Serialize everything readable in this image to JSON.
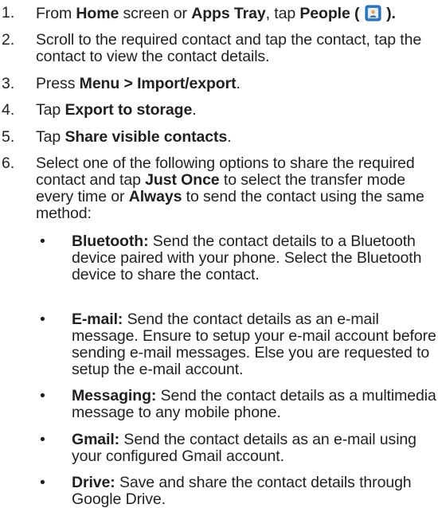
{
  "steps": [
    {
      "num": "1.",
      "parts": [
        {
          "t": "From "
        },
        {
          "t": "Home",
          "b": true
        },
        {
          "t": " screen or "
        },
        {
          "t": "Apps Tray",
          "b": true
        },
        {
          "t": ", tap "
        },
        {
          "t": "People ( ",
          "b": true
        },
        {
          "icon": "people-icon"
        },
        {
          "t": " ).",
          "b": true
        }
      ]
    },
    {
      "num": "2.",
      "parts": [
        {
          "t": "Scroll to the required contact and tap the contact, tap the contact to view the contact details."
        }
      ]
    },
    {
      "num": "3.",
      "parts": [
        {
          "t": "Press "
        },
        {
          "t": "Menu > Import/export",
          "b": true
        },
        {
          "t": "."
        }
      ]
    },
    {
      "num": "4.",
      "parts": [
        {
          "t": "Tap "
        },
        {
          "t": "Export to storage",
          "b": true
        },
        {
          "t": "."
        }
      ]
    },
    {
      "num": "5.",
      "parts": [
        {
          "t": "Tap "
        },
        {
          "t": "Share visible contacts",
          "b": true
        },
        {
          "t": "."
        }
      ]
    },
    {
      "num": "6.",
      "parts": [
        {
          "t": "Select one of the following options to share the required contact and tap "
        },
        {
          "t": "Just Once",
          "b": true
        },
        {
          "t": " to select the transfer mode every time or "
        },
        {
          "t": "Always",
          "b": true
        },
        {
          "t": " to send the contact using the same method:"
        }
      ]
    }
  ],
  "bullets": [
    {
      "symbol": "•",
      "parts": [
        {
          "t": "Bluetooth:",
          "b": true
        },
        {
          "t": " Send the contact details to a Bluetooth device paired with your phone. Select the Bluetooth device to share the contact."
        }
      ]
    },
    {
      "symbol": "•",
      "parts": [
        {
          "t": "E-mail:",
          "b": true
        },
        {
          "t": " Send the contact details as an e-mail message. Ensure to setup your e-mail account before sending e-mail messages. Else you are requested to setup the e-mail account."
        }
      ]
    },
    {
      "symbol": "•",
      "parts": [
        {
          "t": "Messaging:",
          "b": true
        },
        {
          "t": " Send the contact details as a multimedia message to any mobile phone."
        }
      ]
    },
    {
      "symbol": "•",
      "parts": [
        {
          "t": "Gmail:",
          "b": true
        },
        {
          "t": " Send the contact details as an e-mail using your configured Gmail account."
        }
      ]
    },
    {
      "symbol": "•",
      "parts": [
        {
          "t": "Drive:",
          "b": true
        },
        {
          "t": "  Save and share the contact details through Google Drive."
        }
      ]
    }
  ]
}
